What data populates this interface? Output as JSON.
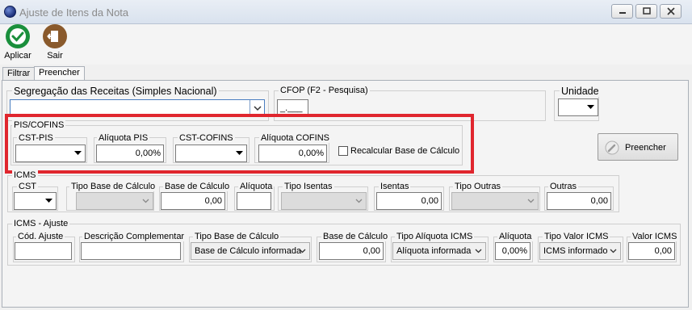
{
  "window": {
    "title": "Ajuste de Itens da Nota"
  },
  "toolbar": {
    "apply_label": "Aplicar",
    "exit_label": "Sair"
  },
  "tabs": [
    "Filtrar",
    "Preencher"
  ],
  "segregacao": {
    "label": "Segregação das Receitas (Simples Nacional)",
    "value": ""
  },
  "cfop": {
    "label": "CFOP (F2 - Pesquisa)",
    "value": "_.___"
  },
  "unidade": {
    "label": "Unidade",
    "value": ""
  },
  "pis_cofins": {
    "title": "PIS/COFINS",
    "cst_pis_label": "CST-PIS",
    "aliquota_pis_label": "Alíquota PIS",
    "aliquota_pis_value": "0,00%",
    "cst_cofins_label": "CST-COFINS",
    "aliquota_cofins_label": "Alíquota COFINS",
    "aliquota_cofins_value": "0,00%",
    "recalc_label": "Recalcular Base de Cálculo"
  },
  "preencher_button": {
    "label": "Preencher"
  },
  "icms": {
    "title": "ICMS",
    "cst_label": "CST",
    "tipo_base_label": "Tipo Base de Cálculo",
    "base_label": "Base de Cálculo",
    "base_value": "0,00",
    "aliquota_label": "Alíquota",
    "aliquota_value": "",
    "tipo_isentas_label": "Tipo Isentas",
    "isentas_label": "Isentas",
    "isentas_value": "0,00",
    "tipo_outras_label": "Tipo Outras",
    "outras_label": "Outras",
    "outras_value": "0,00"
  },
  "icms_ajuste": {
    "title": "ICMS - Ajuste",
    "cod_label": "Cód. Ajuste",
    "desc_label": "Descrição Complementar",
    "tipo_base_label": "Tipo Base de Cálculo",
    "tipo_base_value": "Base de Cálculo informada",
    "base_label": "Base de Cálculo",
    "base_value": "0,00",
    "tipo_aliquota_label": "Tipo Alíquota ICMS",
    "tipo_aliquota_value": "Alíquota informada",
    "aliquota_label": "Alíquota",
    "aliquota_value": "0,00%",
    "tipo_valor_label": "Tipo Valor ICMS",
    "tipo_valor_value": "ICMS informado",
    "valor_label": "Valor ICMS",
    "valor_value": "0,00"
  },
  "colors": {
    "highlight": "#e0262e",
    "apply_icon": "#1a8f3c",
    "exit_icon": "#8a5a2c"
  }
}
